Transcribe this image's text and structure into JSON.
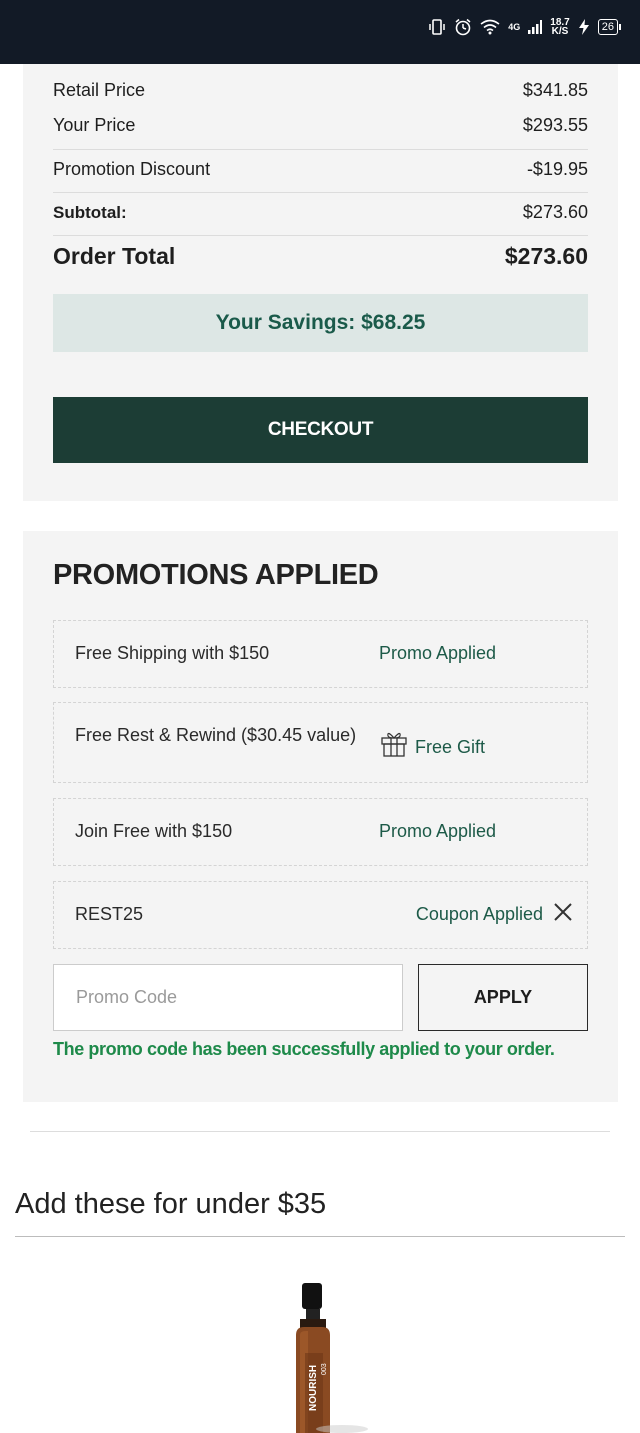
{
  "status_bar": {
    "network": "4G",
    "speed_value": "18.7",
    "speed_unit": "K/S",
    "battery": "26"
  },
  "summary": {
    "retail_price_label": "Retail Price",
    "retail_price_value": "$341.85",
    "your_price_label": "Your Price",
    "your_price_value": "$293.55",
    "promotion_discount_label": "Promotion Discount",
    "promotion_discount_value": "-$19.95",
    "subtotal_label": "Subtotal:",
    "subtotal_value": "$273.60",
    "order_total_label": "Order Total",
    "order_total_value": "$273.60",
    "savings_text": "Your Savings: $68.25",
    "checkout_label": "CHECKOUT"
  },
  "promotions": {
    "title": "PROMOTIONS APPLIED",
    "items": [
      {
        "name": "Free Shipping with $150",
        "status": "Promo Applied"
      },
      {
        "name": "Free Rest & Rewind ($30.45 value)",
        "status": "Free Gift",
        "icon": "gift-icon"
      },
      {
        "name": "Join Free with $150",
        "status": "Promo Applied"
      },
      {
        "name": "REST25",
        "status": "Coupon Applied",
        "icon": "close-icon"
      }
    ],
    "input_placeholder": "Promo Code",
    "apply_label": "APPLY",
    "success_message": "The promo code has been successfully applied to your order."
  },
  "upsell": {
    "title": "Add these for under $35",
    "product_label": "NOURISH",
    "product_label_small": "003"
  },
  "colors": {
    "brand_dark_green": "#1c3d35",
    "savings_bg": "#dde7e5",
    "success_green": "#1e8a4a",
    "status_bar": "#121a26"
  }
}
